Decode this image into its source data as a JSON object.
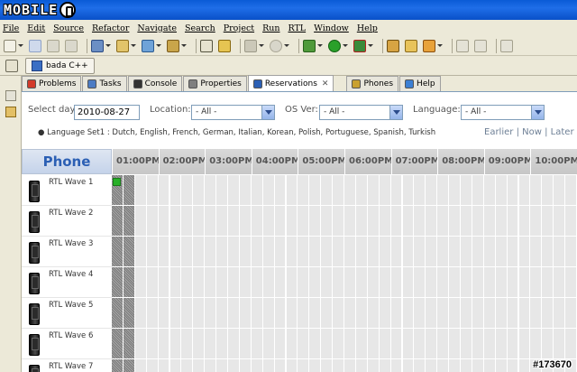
{
  "title_bar": {
    "logo_text": "MOBILE"
  },
  "menu": [
    "File",
    "Edit",
    "Source",
    "Refactor",
    "Navigate",
    "Search",
    "Project",
    "Run",
    "RTL",
    "Window",
    "Help"
  ],
  "perspective": {
    "label": "bada C++"
  },
  "tabs": [
    {
      "label": "Problems",
      "icon": "problems-icon",
      "active": false
    },
    {
      "label": "Tasks",
      "icon": "tasks-icon",
      "active": false
    },
    {
      "label": "Console",
      "icon": "console-icon",
      "active": false
    },
    {
      "label": "Properties",
      "icon": "properties-icon",
      "active": false
    },
    {
      "label": "Reservations",
      "icon": "clock-icon",
      "active": true
    },
    {
      "label": "Phones",
      "icon": "phones-icon",
      "active": false
    },
    {
      "label": "Help",
      "icon": "help-icon",
      "active": false
    }
  ],
  "close_glyph": "✕",
  "filters": {
    "day_label": "Select day:",
    "day_value": "2010-08-27",
    "location_label": "Location:",
    "location_value": "- All -",
    "os_label": "OS Ver:",
    "os_value": "- All -",
    "language_label": "Language:",
    "language_value": "- All -"
  },
  "language_set": "● Language Set1 : Dutch, English, French, German, Italian, Korean, Polish, Portuguese, Spanish, Turkish",
  "nav": {
    "earlier": "Earlier",
    "sep": "|",
    "now": "Now",
    "later": "Later"
  },
  "grid": {
    "phone_header": "Phone",
    "times": [
      "01:00PM",
      "02:00PM",
      "03:00PM",
      "04:00PM",
      "05:00PM",
      "06:00PM",
      "07:00PM",
      "08:00PM",
      "09:00PM",
      "10:00PM"
    ],
    "rows": [
      "RTL Wave 1",
      "RTL Wave 2",
      "RTL Wave 3",
      "RTL Wave 4",
      "RTL Wave 5",
      "RTL Wave 6",
      "RTL Wave 7"
    ],
    "booked_slot": {
      "row": 0,
      "cell": 0
    },
    "busy_cells_per_row": 2
  },
  "watermark": "#173670",
  "colors": {
    "title_blue": "#0a5bd6",
    "phone_header_text": "#2b5fb4",
    "booked_green": "#28b028"
  }
}
